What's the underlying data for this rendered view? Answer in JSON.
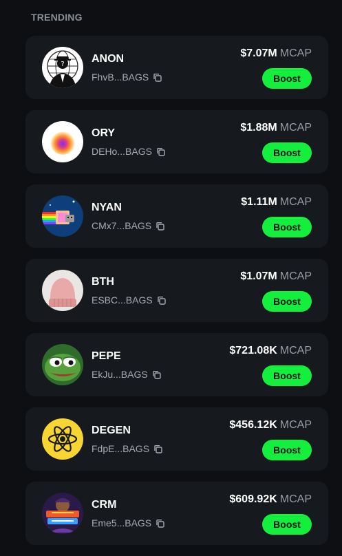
{
  "section": {
    "title": "TRENDING"
  },
  "colors": {
    "boost_bg": "#13ef3c",
    "card_bg": "#16191d",
    "page_bg": "#0d0f12"
  },
  "tokens": [
    {
      "name": "ANON",
      "address": "FhvB...BAGS",
      "mcap": "$7.07M",
      "mcap_unit": "MCAP",
      "boost_label": "Boost",
      "avatar_icon": "anonymous-mask-icon"
    },
    {
      "name": "ORY",
      "address": "DEHo...BAGS",
      "mcap": "$1.88M",
      "mcap_unit": "MCAP",
      "boost_label": "Boost",
      "avatar_icon": "gradient-orb-icon"
    },
    {
      "name": "NYAN",
      "address": "CMx7...BAGS",
      "mcap": "$1.11M",
      "mcap_unit": "MCAP",
      "boost_label": "Boost",
      "avatar_icon": "nyan-cat-icon"
    },
    {
      "name": "BTH",
      "address": "ESBC...BAGS",
      "mcap": "$1.07M",
      "mcap_unit": "MCAP",
      "boost_label": "Boost",
      "avatar_icon": "pink-beanie-icon"
    },
    {
      "name": "PEPE",
      "address": "EkJu...BAGS",
      "mcap": "$721.08K",
      "mcap_unit": "MCAP",
      "boost_label": "Boost",
      "avatar_icon": "pepe-frog-icon"
    },
    {
      "name": "DEGEN",
      "address": "FdpE...BAGS",
      "mcap": "$456.12K",
      "mcap_unit": "MCAP",
      "boost_label": "Boost",
      "avatar_icon": "atom-icon"
    },
    {
      "name": "CRM",
      "address": "Eme5...BAGS",
      "mcap": "$609.92K",
      "mcap_unit": "MCAP",
      "boost_label": "Boost",
      "avatar_icon": "crypto-rug-muncher-logo-icon"
    }
  ]
}
